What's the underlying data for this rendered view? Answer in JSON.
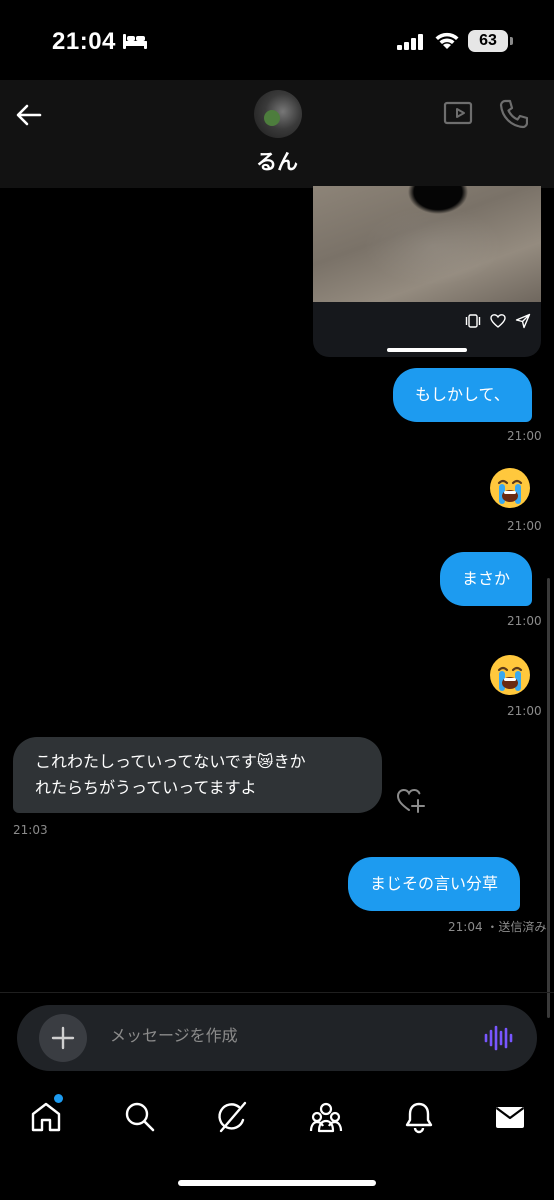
{
  "status_bar": {
    "time": "21:04",
    "battery": "63",
    "icons": [
      "bed-icon",
      "signal-icon",
      "wifi-icon",
      "battery-icon"
    ]
  },
  "header": {
    "contact_name": "るん",
    "icons": [
      "back-arrow-icon",
      "avatar",
      "video-call-icon",
      "phone-call-icon"
    ]
  },
  "shared_post": {
    "icons": [
      "gallery-icon",
      "heart-icon",
      "share-icon"
    ]
  },
  "messages": [
    {
      "side": "sent",
      "text": "もしかして、",
      "time": "21:00"
    },
    {
      "side": "sent",
      "emoji": "😭",
      "time": "21:00"
    },
    {
      "side": "sent",
      "text": "まさか",
      "time": "21:00"
    },
    {
      "side": "sent",
      "emoji": "😭",
      "time": "21:00"
    },
    {
      "side": "received",
      "text_line1": "これわたしっていってないです😿きか",
      "text_line2": "れたらちがうっていってますよ",
      "time": "21:03"
    },
    {
      "side": "sent",
      "text": "まじその言い分草",
      "time": "21:04",
      "status": "・送信済み"
    }
  ],
  "composer": {
    "placeholder": "メッセージを作成",
    "icons": [
      "plus-icon",
      "voice-wave-icon"
    ]
  },
  "tab_bar": {
    "tabs": [
      "home",
      "search",
      "grok",
      "communities",
      "notifications",
      "messages"
    ],
    "home_has_notification_dot": true
  },
  "colors": {
    "accent": "#1d9bf0",
    "received_bubble": "#2f3336",
    "background": "#000000",
    "voice_icon": "#7856ff"
  }
}
